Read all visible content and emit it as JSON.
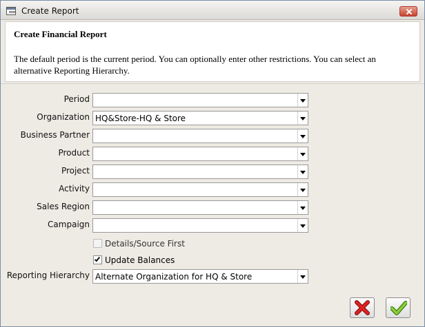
{
  "window": {
    "title": "Create Report"
  },
  "header": {
    "title": "Create Financial Report",
    "description": "The default period is the current period.  You can optionally enter other restrictions.  You can select an alternative Reporting Hierarchy."
  },
  "fields": [
    {
      "label": "Period",
      "value": ""
    },
    {
      "label": "Organization",
      "value": "HQ&Store-HQ & Store"
    },
    {
      "label": "Business Partner",
      "value": ""
    },
    {
      "label": "Product",
      "value": ""
    },
    {
      "label": "Project",
      "value": ""
    },
    {
      "label": "Activity",
      "value": ""
    },
    {
      "label": "Sales Region",
      "value": ""
    },
    {
      "label": "Campaign",
      "value": ""
    }
  ],
  "checkboxes": [
    {
      "label": "Details/Source First",
      "checked": false,
      "enabled": false
    },
    {
      "label": "Update Balances",
      "checked": true,
      "enabled": true
    }
  ],
  "hierarchy": {
    "label": "Reporting Hierarchy",
    "value": "Alternate Organization for HQ & Store"
  },
  "buttons": {
    "cancel_icon": "red-x-icon",
    "ok_icon": "green-check-icon"
  }
}
